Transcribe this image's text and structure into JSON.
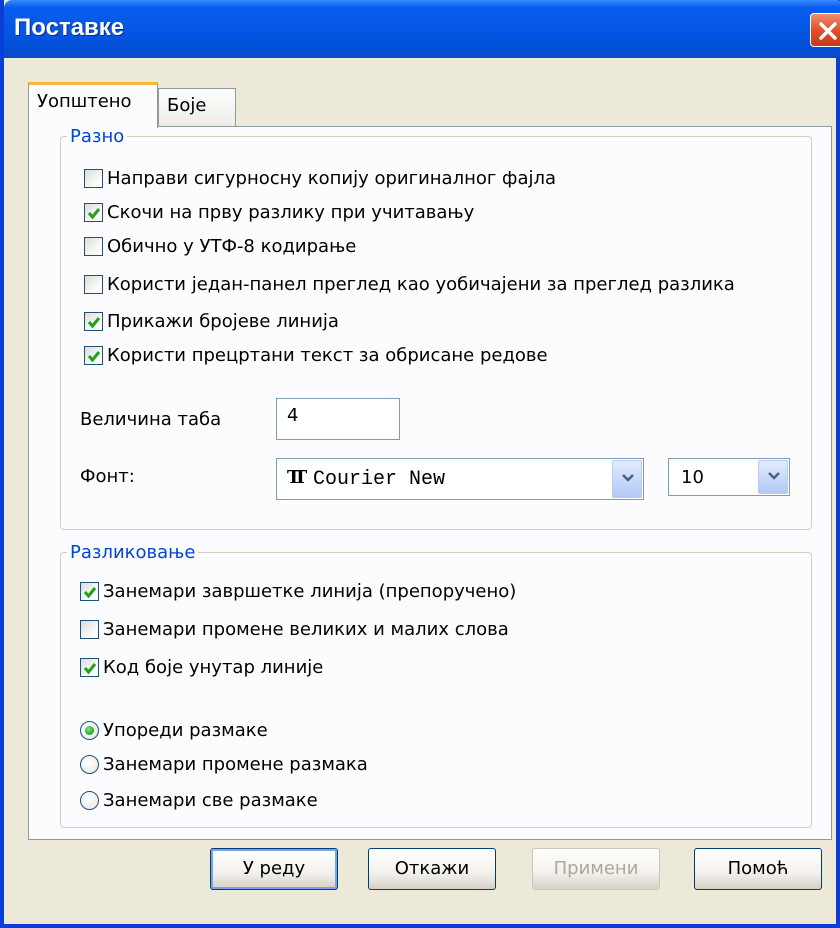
{
  "window": {
    "title": "Поставке"
  },
  "tabs": [
    {
      "label": "Уопштено",
      "active": true
    },
    {
      "label": "Боје",
      "active": false
    }
  ],
  "misc_group": {
    "legend": "Разно",
    "checkboxes": [
      {
        "label": "Направи сигурносну копију оригиналног фајла",
        "checked": false
      },
      {
        "label": "Скочи на прву разлику при учитавању",
        "checked": true
      },
      {
        "label": "Обично у УТФ-8 кодирање",
        "checked": false
      },
      {
        "label": "Користи један-панел преглед као уобичајени за преглед разлика",
        "checked": false
      },
      {
        "label": "Прикажи бројеве линија",
        "checked": true
      },
      {
        "label": "Користи прецртани текст за обрисане редове",
        "checked": true
      }
    ],
    "tab_size_label": "Величина таба",
    "tab_size_value": "4",
    "font_label": "Фонт:",
    "font_value": "Courier New",
    "font_size_value": "10"
  },
  "diff_group": {
    "legend": "Разликовање",
    "checkboxes": [
      {
        "label": "Занемари завршетке линија (препоручено)",
        "checked": true
      },
      {
        "label": "Занемари промене великих и малих слова",
        "checked": false
      },
      {
        "label": "Код боје унутар линије",
        "checked": true
      }
    ],
    "radios": [
      {
        "label": "Упореди размаке",
        "selected": true
      },
      {
        "label": "Занемари промене размака",
        "selected": false
      },
      {
        "label": "Занемари све размаке",
        "selected": false
      }
    ]
  },
  "buttons": {
    "ok": "У реду",
    "cancel": "Откажи",
    "apply": "Примени",
    "help": "Помоћ"
  },
  "colors": {
    "titlebar": "#0558e6",
    "legend_text": "#0046d5",
    "check_mark": "#21a121"
  }
}
